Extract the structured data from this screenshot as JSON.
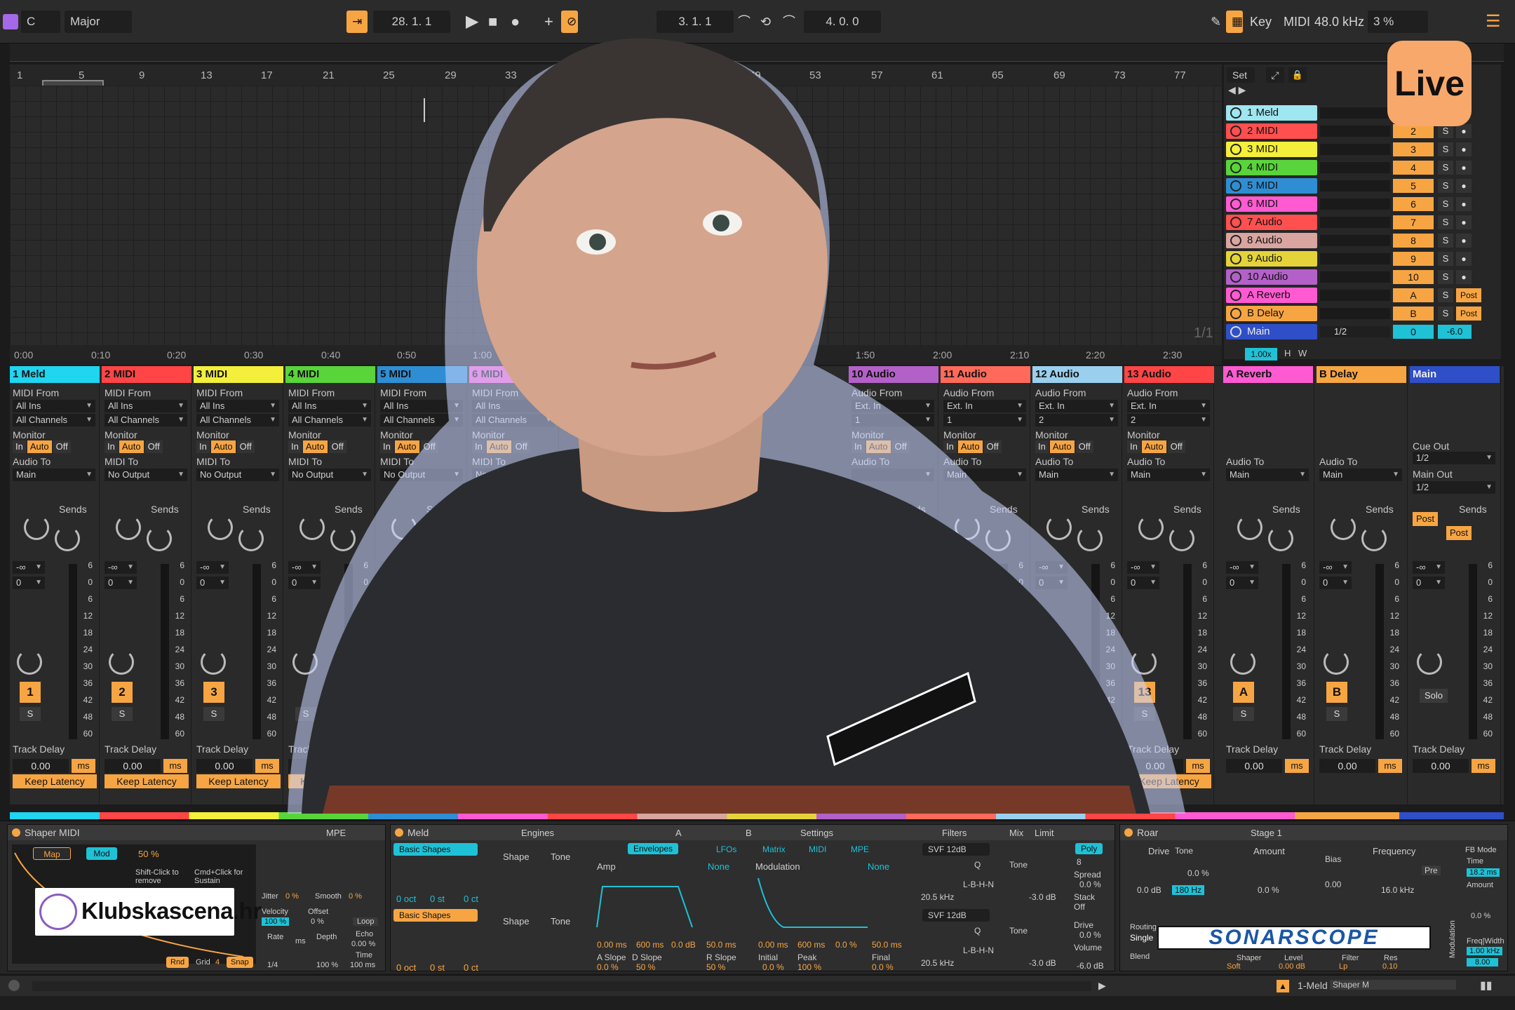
{
  "topbar": {
    "root": "C",
    "scale": "Major",
    "position": "28. 1. 1",
    "loop_start": "3. 1. 1",
    "loop_length": "4. 0. 0",
    "key": "Key",
    "midi": "MIDI",
    "sample_rate": "48.0 kHz",
    "cpu": "3 %"
  },
  "ruler": [
    "1",
    "5",
    "9",
    "13",
    "17",
    "21",
    "25",
    "29",
    "33",
    "49",
    "53",
    "57",
    "61",
    "65",
    "69",
    "73",
    "77"
  ],
  "timeline": [
    "0:00",
    "0:10",
    "0:20",
    "0:30",
    "0:40",
    "0:50",
    "1:00",
    "1:50",
    "2:00",
    "2:10",
    "2:20",
    "2:30"
  ],
  "page_counter": "1/1",
  "set_button": "Set",
  "tracks": [
    {
      "name": "1 Meld",
      "num": "",
      "color": "#9ee6f0"
    },
    {
      "name": "2 MIDI",
      "num": "2",
      "color": "#ff4f4f"
    },
    {
      "name": "3 MIDI",
      "num": "3",
      "color": "#f3ef3a"
    },
    {
      "name": "4 MIDI",
      "num": "4",
      "color": "#59d43a"
    },
    {
      "name": "5 MIDI",
      "num": "5",
      "color": "#2f8ed3"
    },
    {
      "name": "6 MIDI",
      "num": "6",
      "color": "#ff5ad1"
    },
    {
      "name": "7 Audio",
      "num": "7",
      "color": "#ff4f4f"
    },
    {
      "name": "8 Audio",
      "num": "8",
      "color": "#d8a5a0"
    },
    {
      "name": "9 Audio",
      "num": "9",
      "color": "#e4d43a"
    },
    {
      "name": "10 Audio",
      "num": "10",
      "color": "#b361c8"
    },
    {
      "name": "A Reverb",
      "num": "A",
      "color": "#ff5ad1"
    },
    {
      "name": "B Delay",
      "num": "B",
      "color": "#f7a543"
    },
    {
      "name": "Main",
      "num": "0",
      "color": "#2f4fc8"
    }
  ],
  "main_row": {
    "split": "1/2",
    "volume": "-6.0",
    "zoom": "1.00x",
    "h": "H",
    "w": "W"
  },
  "strips": [
    {
      "name": "1 Meld",
      "color": "#1fd5f0",
      "from_label": "MIDI From",
      "from": "All Ins",
      "channel": "All Channels",
      "to": "Main",
      "num": "1",
      "to_label": "Audio To"
    },
    {
      "name": "2 MIDI",
      "color": "#ff4545",
      "from_label": "MIDI From",
      "from": "All Ins",
      "channel": "All Channels",
      "to": "No Output",
      "num": "2",
      "to_label": "MIDI To"
    },
    {
      "name": "3 MIDI",
      "color": "#f3ef3a",
      "from_label": "MIDI From",
      "from": "All Ins",
      "channel": "All Channels",
      "to": "No Output",
      "num": "3",
      "to_label": "MIDI To"
    },
    {
      "name": "4 MIDI",
      "color": "#59d43a",
      "from_label": "MIDI From",
      "from": "All Ins",
      "channel": "All Channels",
      "to": "No Output",
      "num": "",
      "to_label": "MIDI To"
    },
    {
      "name": "5 MIDI",
      "color": "#2f8ed3",
      "from_label": "MIDI From",
      "from": "All Ins",
      "channel": "All Channels",
      "to": "No Output",
      "num": "",
      "to_label": "MIDI To"
    },
    {
      "name": "6 MIDI",
      "color": "#ff5ad1",
      "from_label": "MIDI From",
      "from": "All Ins",
      "channel": "All Channels",
      "to": "No Output",
      "num": "",
      "to_label": "MIDI To"
    }
  ],
  "right_strips": [
    {
      "name": "10 Audio",
      "color": "#b361c8",
      "from_label": "Audio From",
      "from": "Ext. In",
      "channel": "1",
      "to": "",
      "num": ""
    },
    {
      "name": "11 Audio",
      "color": "#ff6a5a",
      "from_label": "Audio From",
      "from": "Ext. In",
      "channel": "1",
      "to": "Main",
      "num": ""
    },
    {
      "name": "12 Audio",
      "color": "#9ad0ee",
      "from_label": "Audio From",
      "from": "Ext. In",
      "channel": "2",
      "to": "Main",
      "num": ""
    },
    {
      "name": "13 Audio",
      "color": "#ff4545",
      "from_label": "Audio From",
      "from": "Ext. In",
      "channel": "2",
      "to": "Main",
      "num": "13"
    }
  ],
  "returns": [
    {
      "name": "A Reverb",
      "color": "#ff5ad1",
      "to": "Main",
      "num": "A"
    },
    {
      "name": "B Delay",
      "color": "#f7a543",
      "to": "Main",
      "num": "B"
    },
    {
      "name": "Main",
      "color": "#2f4fc8",
      "cue": "1/2",
      "main_out": "1/2"
    }
  ],
  "mixer_labels": {
    "monitor": "Monitor",
    "in": "In",
    "auto": "Auto",
    "off": "Off",
    "sends": "Sends",
    "a": "A",
    "b": "B",
    "track_delay": "Track Delay",
    "delay_value": "0.00",
    "ms": "ms",
    "keep_latency": "Keep Latency",
    "s": "S",
    "neg_inf": "-∞",
    "zero": "0",
    "cue_out": "Cue Out",
    "main_out": "Main Out",
    "post": "Post",
    "solo": "Solo",
    "audio_to": "Audio To"
  },
  "meter_scale": [
    "6",
    "0",
    "6",
    "12",
    "18",
    "24",
    "30",
    "36",
    "42",
    "48",
    "60"
  ],
  "devices": {
    "shaper": {
      "title": "Shaper MIDI",
      "mpe": "MPE",
      "map": "Map",
      "mod": "Mod",
      "pct": "50 %",
      "hint1": "Shift-Click to remove",
      "hint2": "Cmd+Click for Sustain",
      "jitter": "Jitter",
      "jitter_val": "0 %",
      "smooth": "Smooth",
      "smooth_val": "0 %",
      "velocity": "Velocity",
      "velocity_val": "100 %",
      "offset": "Offset",
      "offset_val": "0 %",
      "loop": "Loop",
      "rate": "Rate",
      "rate_val": "1/4",
      "depth": "Depth",
      "depth_val": "100 %",
      "echo": "Echo",
      "echo_val": "0.00 %",
      "time": "Time",
      "time_val": "100 ms",
      "rnd": "Rnd",
      "grid": "Grid",
      "grid_val": "4",
      "snap": "Snap",
      "ms": "ms"
    },
    "meld": {
      "title": "Meld",
      "engines": "Engines",
      "a": "A",
      "b": "B",
      "settings": "Settings",
      "basic_shapes": "Basic Shapes",
      "shape": "Shape",
      "tone": "Tone",
      "zero": "0.0",
      "oct": "0 oct",
      "st": "0 st",
      "ct": "0 ct",
      "envelopes": "Envelopes",
      "lfos": "LFOs",
      "matrix": "Matrix",
      "midi": "MIDI",
      "mpe": "MPE",
      "amp": "Amp",
      "none": "None",
      "modulation": "Modulation",
      "env_a": "A",
      "env_d": "D",
      "env_s": "S",
      "env_r": "R",
      "a_val": "0.00 ms",
      "d_val": "600 ms",
      "s_val": "0.0 dB",
      "r_val": "50.0 ms",
      "m_a_val": "0.00 ms",
      "m_d_val": "600 ms",
      "m_s_val": "0.0 %",
      "m_r_val": "50.0 ms",
      "a_slope": "A Slope",
      "d_slope": "D Slope",
      "r_slope": "R Slope",
      "initial": "Initial",
      "peak": "Peak",
      "final": "Final",
      "a_slope_val": "0.0 %",
      "d_slope_val": "50 %",
      "r_slope_val": "50 %",
      "initial_val": "0.0 %",
      "peak_val": "100 %",
      "final_val": "0.0 %",
      "filters": "Filters",
      "svf": "SVF 12dB",
      "q": "Q",
      "lbhn": "L-B-H-N",
      "freq": "20.5 kHz",
      "mix": "Mix",
      "limit": "Limit",
      "c": "C",
      "tone2": "Tone",
      "db": "-3.0 dB",
      "poly": "Poly",
      "voices": "8",
      "spread": "Spread",
      "spread_val": "0.0 %",
      "stack": "Stack",
      "stack_val": "Off",
      "drive": "Drive",
      "drive_val": "0.0 %",
      "volume": "Volume",
      "volume_val": "-6.0 dB"
    },
    "roar": {
      "title": "Roar",
      "stage": "Stage 1",
      "drive": "Drive",
      "drive_val": "0.0 dB",
      "tone": "Tone",
      "tone_val": "0.0 %",
      "tone_freq": "180 Hz",
      "amount": "Amount",
      "amount_val": "0.0 %",
      "bias": "Bias",
      "bias_val": "0.00",
      "frequency": "Frequency",
      "frequency_val": "16.0 kHz",
      "pre": "Pre",
      "routing": "Routing",
      "single": "Single",
      "blend": "Blend",
      "shaper": "Shaper",
      "soft": "Soft",
      "level": "Level",
      "level_val": "0.00 dB",
      "filter": "Filter",
      "lp": "Lp",
      "res": "Res",
      "res_val": "0.10",
      "fb_mode": "FB Mode",
      "time": "Time",
      "time_val": "18.2 ms",
      "amount2": "Amount",
      "amount2_val": "0.0 %",
      "freq_width": "Freq|Width",
      "fw_val": "1.00 kHz",
      "fw_val2": "8.00",
      "modulation": "Modulation"
    }
  },
  "status": {
    "track": "1-Meld",
    "device": "Shaper M"
  },
  "overlays": {
    "live_badge": "Live",
    "klub": "Klubskascena.hr",
    "sonar": "SONARSCOPE"
  }
}
